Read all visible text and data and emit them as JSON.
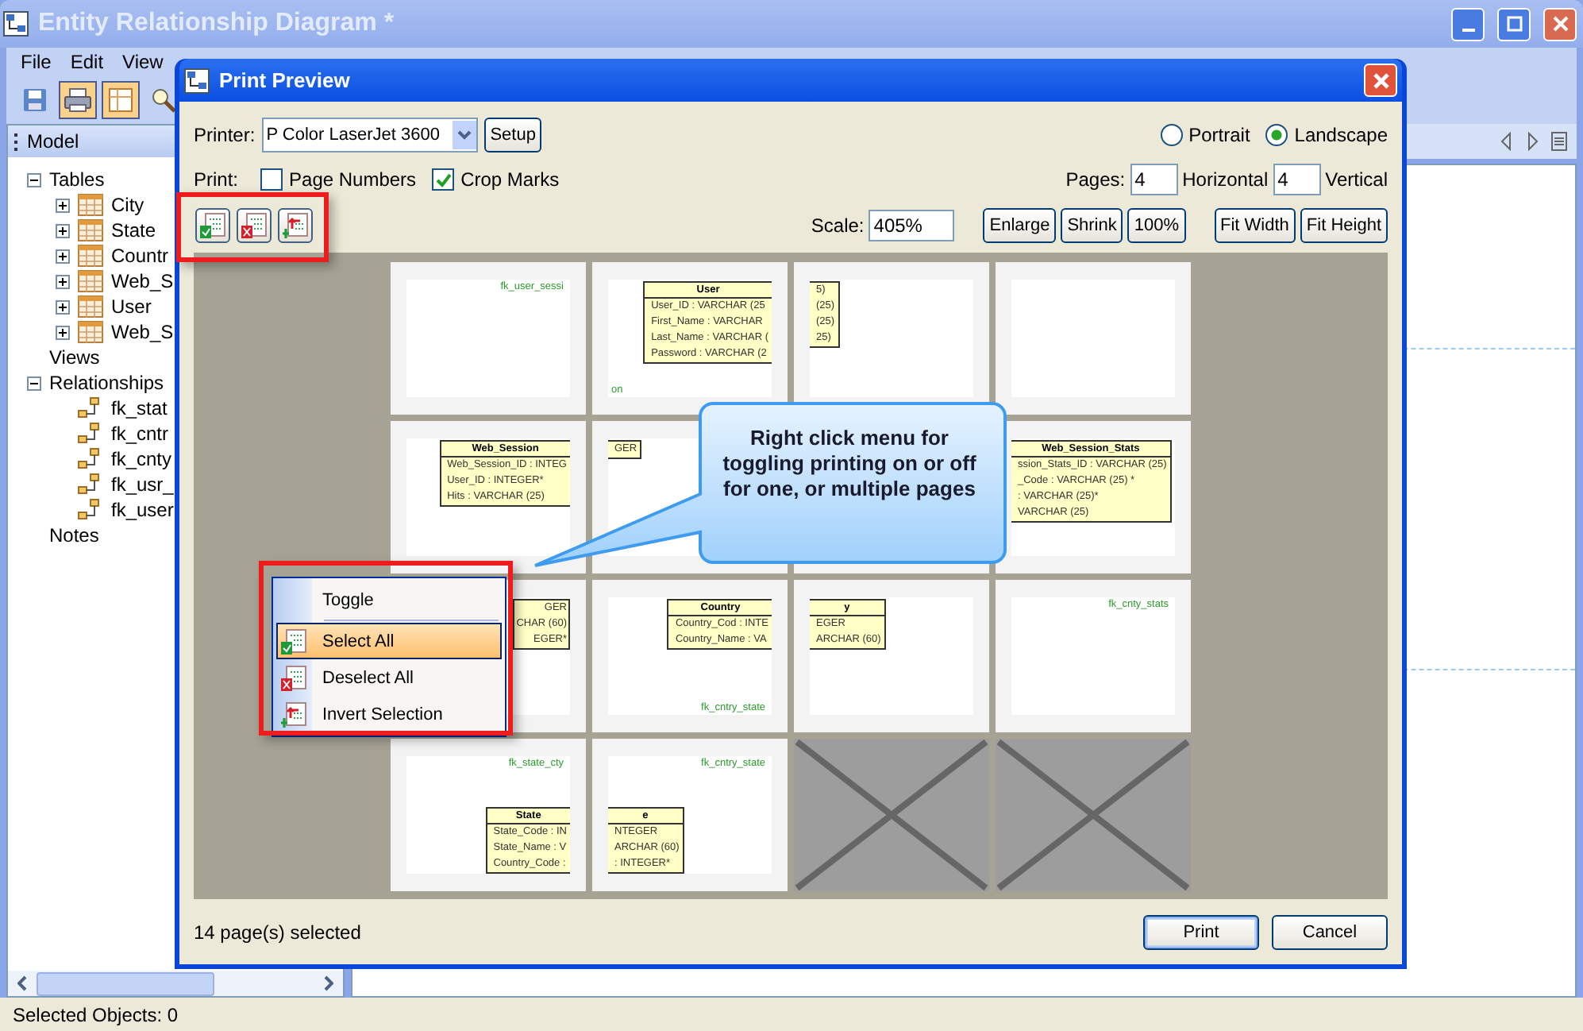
{
  "window": {
    "title": "Entity Relationship Diagram *"
  },
  "menu": [
    "File",
    "Edit",
    "View"
  ],
  "toolbar": [
    {
      "pressed": false
    },
    {
      "pressed": true
    },
    {
      "pressed": true
    },
    {
      "pressed": false
    }
  ],
  "model_panel": {
    "title": "Model",
    "tree": [
      {
        "label": "Tables",
        "expanded": true,
        "children": [
          {
            "label": "City",
            "kind": "table",
            "expanded": false
          },
          {
            "label": "State",
            "kind": "table",
            "expanded": false
          },
          {
            "label": "Countr",
            "kind": "table",
            "expanded": false
          },
          {
            "label": "Web_S",
            "kind": "table",
            "expanded": false
          },
          {
            "label": "User",
            "kind": "table",
            "expanded": false
          },
          {
            "label": "Web_S",
            "kind": "table",
            "expanded": false
          }
        ]
      },
      {
        "label": "Views"
      },
      {
        "label": "Relationships",
        "expanded": true,
        "children": [
          {
            "label": "fk_stat",
            "kind": "relationship"
          },
          {
            "label": "fk_cntr",
            "kind": "relationship"
          },
          {
            "label": "fk_cnty",
            "kind": "relationship"
          },
          {
            "label": "fk_usr_",
            "kind": "relationship"
          },
          {
            "label": "fk_user",
            "kind": "relationship"
          }
        ]
      },
      {
        "label": "Notes"
      }
    ]
  },
  "status_bar": "Selected Objects: 0",
  "dialog": {
    "title": "Print Preview",
    "printer": {
      "label": "Printer:",
      "value": "P Color LaserJet 3600"
    },
    "setup_button": "Setup",
    "orientation": [
      {
        "label": "Portrait",
        "selected": false
      },
      {
        "label": "Landscape",
        "selected": true
      }
    ],
    "print_label": "Print:",
    "print_options": [
      {
        "label": "Page Numbers",
        "checked": false
      },
      {
        "label": "Crop Marks",
        "checked": true
      }
    ],
    "pages": {
      "label": "Pages:",
      "horizontal": "4",
      "horizontal_label": "Horizontal",
      "vertical": "4",
      "vertical_label": "Vertical"
    },
    "scale": {
      "label": "Scale:",
      "value": "405%"
    },
    "zoom_buttons": [
      "Enlarge",
      "Shrink",
      "100%"
    ],
    "fit_buttons": [
      "Fit Width",
      "Fit Height"
    ],
    "preview_pages": [
      {
        "selected": true,
        "items": [
          {
            "kind": "label",
            "text": "fk_user_sessi"
          }
        ]
      },
      {
        "selected": true,
        "items": [
          {
            "kind": "entity_head",
            "title": "User",
            "fields": [
              "User_ID : VARCHAR (25",
              "First_Name : VARCHAR",
              "Last_Name : VARCHAR (",
              "Password : VARCHAR (2"
            ]
          },
          {
            "kind": "label_tail",
            "text": "on"
          }
        ]
      },
      {
        "selected": true,
        "items": [
          {
            "kind": "entity_tail",
            "fields": [
              "5)",
              "(25)",
              "(25)",
              "25)"
            ]
          }
        ]
      },
      {
        "selected": true
      },
      {
        "selected": true,
        "items": [
          {
            "kind": "entity_head",
            "title": "Web_Session",
            "fields": [
              "Web_Session_ID : INTEG",
              "User_ID : INTEGER*",
              "Hits : VARCHAR (25)"
            ]
          }
        ]
      },
      {
        "selected": true,
        "items": [
          {
            "kind": "entity_tail",
            "fields": [
              "GER"
            ]
          }
        ]
      },
      {
        "selected": true
      },
      {
        "selected": true,
        "items": [
          {
            "kind": "entity_tail",
            "title": "Web_Session_Stats",
            "fields": [
              "ssion_Stats_ID : VARCHAR (25)",
              "_Code : VARCHAR (25) *",
              ": VARCHAR (25)*",
              "VARCHAR (25)"
            ]
          }
        ]
      },
      {
        "selected": true,
        "items": [
          {
            "kind": "entity_fragment",
            "fields": [
              "GER",
              "CHAR (60)",
              "EGER*"
            ]
          }
        ]
      },
      {
        "selected": true,
        "items": [
          {
            "kind": "entity_head",
            "title": "Country",
            "fields": [
              "Country_Cod : INTE",
              "Country_Name : VA"
            ]
          },
          {
            "kind": "label",
            "text": "fk_cntry_state"
          }
        ]
      },
      {
        "selected": true,
        "items": [
          {
            "kind": "entity_tail",
            "title": "y",
            "fields": [
              "EGER",
              "ARCHAR (60)"
            ]
          }
        ]
      },
      {
        "selected": true,
        "items": [
          {
            "kind": "label",
            "text": "fk_cnty_stats"
          }
        ]
      },
      {
        "selected": true,
        "items": [
          {
            "kind": "label",
            "text": "fk_state_cty"
          },
          {
            "kind": "entity_head",
            "title": "State",
            "fields": [
              "State_Code : IN",
              "State_Name : V",
              "Country_Code :"
            ]
          }
        ]
      },
      {
        "selected": true,
        "items": [
          {
            "kind": "label",
            "text": "fk_cntry_state"
          },
          {
            "kind": "entity_tail",
            "title": "e",
            "fields": [
              "NTEGER",
              "ARCHAR (60)",
              ": INTEGER*"
            ]
          }
        ]
      },
      {
        "selected": false
      },
      {
        "selected": false
      }
    ],
    "context_menu": [
      {
        "label": "Toggle",
        "selected": false
      },
      {
        "label": "Select All",
        "selected": true
      },
      {
        "label": "Deselect All",
        "selected": false
      },
      {
        "label": "Invert Selection",
        "selected": false
      }
    ],
    "callout": "Right click menu for toggling printing on or off for one, or multiple pages",
    "selection_status": "14 page(s) selected",
    "buttons": [
      {
        "label": "Print",
        "default": true
      },
      {
        "label": "Cancel",
        "default": false
      }
    ]
  }
}
